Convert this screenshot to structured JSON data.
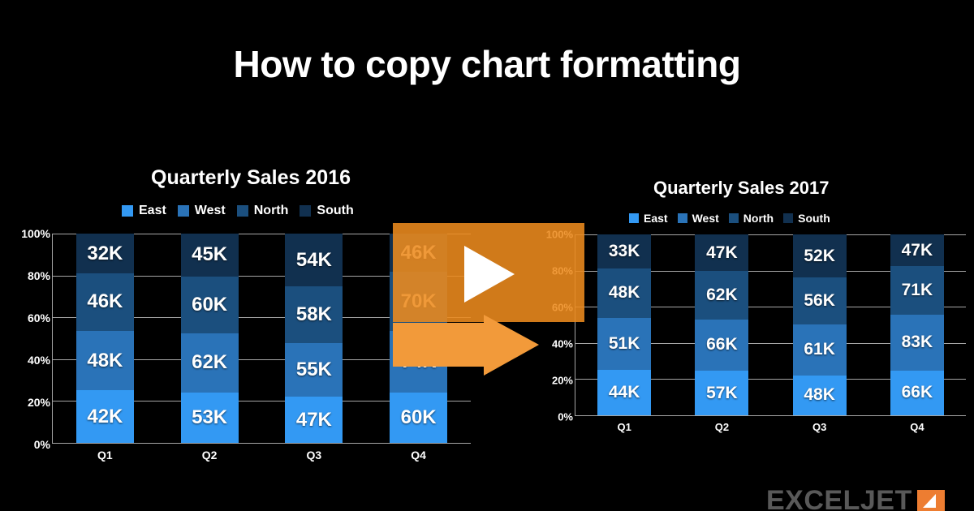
{
  "slide": {
    "title": "How to copy chart formatting",
    "background_color": "#000000"
  },
  "watermark": {
    "text": "EXCELJET",
    "text_color": "#595959",
    "mark_color": "#ed7d31",
    "mark_icon": "exceljet-arrow-icon"
  },
  "overlay": {
    "panel_color": "#ed8b1e",
    "play_icon": "play-triangle-icon",
    "arrow_icon": "right-arrow-icon",
    "arrow_color": "#f29a3a"
  },
  "series_colors": {
    "East": "#3399f3",
    "West": "#2a73b8",
    "North": "#1b4f7e",
    "South": "#11304f"
  },
  "chart_data": [
    {
      "id": "chart-2016",
      "type": "bar",
      "stacked": true,
      "normalized": true,
      "title": "Quarterly Sales 2016",
      "xlabel": "",
      "ylabel": "",
      "grid": true,
      "legend_position": "top",
      "categories": [
        "Q1",
        "Q2",
        "Q3",
        "Q4"
      ],
      "yticks": [
        "100%",
        "80%",
        "60%",
        "40%",
        "20%",
        "0%"
      ],
      "ylim": [
        0,
        100
      ],
      "series": [
        {
          "name": "East",
          "color": "#3399f3",
          "values": [
            42,
            53,
            47,
            60
          ],
          "labels": [
            "42K",
            "53K",
            "47K",
            "60K"
          ]
        },
        {
          "name": "West",
          "color": "#2a73b8",
          "values": [
            48,
            62,
            55,
            74
          ],
          "labels": [
            "48K",
            "62K",
            "55K",
            "74K"
          ]
        },
        {
          "name": "North",
          "color": "#1b4f7e",
          "values": [
            46,
            60,
            58,
            70
          ],
          "labels": [
            "46K",
            "60K",
            "58K",
            "70K"
          ]
        },
        {
          "name": "South",
          "color": "#11304f",
          "values": [
            32,
            45,
            54,
            46
          ],
          "labels": [
            "32K",
            "45K",
            "54K",
            "46K"
          ]
        }
      ]
    },
    {
      "id": "chart-2017",
      "type": "bar",
      "stacked": true,
      "normalized": true,
      "title": "Quarterly Sales 2017",
      "xlabel": "",
      "ylabel": "",
      "grid": true,
      "legend_position": "top",
      "categories": [
        "Q1",
        "Q2",
        "Q3",
        "Q4"
      ],
      "yticks": [
        "100%",
        "80%",
        "60%",
        "40%",
        "20%",
        "0%"
      ],
      "ylim": [
        0,
        100
      ],
      "series": [
        {
          "name": "East",
          "color": "#3399f3",
          "values": [
            44,
            57,
            48,
            66
          ],
          "labels": [
            "44K",
            "57K",
            "48K",
            "66K"
          ]
        },
        {
          "name": "West",
          "color": "#2a73b8",
          "values": [
            51,
            66,
            61,
            83
          ],
          "labels": [
            "51K",
            "66K",
            "61K",
            "83K"
          ]
        },
        {
          "name": "North",
          "color": "#1b4f7e",
          "values": [
            48,
            62,
            56,
            71
          ],
          "labels": [
            "48K",
            "62K",
            "56K",
            "71K"
          ]
        },
        {
          "name": "South",
          "color": "#11304f",
          "values": [
            33,
            47,
            52,
            47
          ],
          "labels": [
            "33K",
            "47K",
            "52K",
            "47K"
          ]
        }
      ]
    }
  ]
}
